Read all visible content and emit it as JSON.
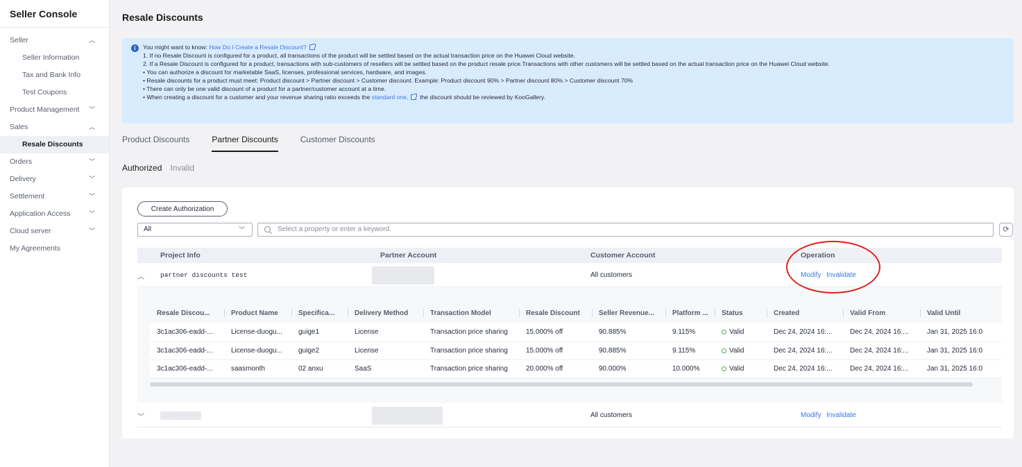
{
  "sidebar": {
    "title": "Seller Console",
    "items": [
      {
        "label": "Seller",
        "chevron": "︿"
      },
      {
        "label": "Seller Information"
      },
      {
        "label": "Tax and Bank Info"
      },
      {
        "label": "Test Coupons"
      },
      {
        "label": "Product Management",
        "chevron": "﹀"
      },
      {
        "label": "Sales",
        "chevron": "︿"
      },
      {
        "label": "Resale Discounts"
      },
      {
        "label": "Orders",
        "chevron": "﹀"
      },
      {
        "label": "Delivery",
        "chevron": "﹀"
      },
      {
        "label": "Settlement",
        "chevron": "﹀"
      },
      {
        "label": "Application Access",
        "chevron": "﹀"
      },
      {
        "label": "Cloud server",
        "chevron": "﹀"
      },
      {
        "label": "My Agreements"
      }
    ]
  },
  "page": {
    "title": "Resale Discounts"
  },
  "notice": {
    "icon": "info-icon",
    "intro": "You might want to know: ",
    "intro_link": "How Do I Create a Resale Discount?",
    "line1": "1. If no Resale Discount is configured for a product, all transactions of the product will be settled based on the actual transaction price on the Huawei Cloud website.",
    "line2": "2. If a Resale Discount is configured for a product, transactions with sub-customers of resellers will be settled based on the product resale price.Transactions with other customers will be settled based on the actual transaction price on the Huawei Cloud website.",
    "line3": "• You can authorize a discount for marketable SaaS, licenses, professional services, hardware, and images.",
    "line4": "• Resale discounts for a product must meet: Product discount > Partner discount > Customer discount. Example: Product discount 90% > Partner discount 80% > Customer discount 70%",
    "line5": "• There can only be one valid discount of a product for a partner/customer account at a time.",
    "line6_a": "• When creating a discount for a customer and your revenue sharing ratio exceeds the ",
    "line6_link": "standard one,",
    "line6_b": "  the discount should be reviewed by KooGallery."
  },
  "tabs": [
    "Product Discounts",
    "Partner Discounts",
    "Customer Discounts"
  ],
  "subtabs": [
    "Authorized",
    "Invalid"
  ],
  "toolbar": {
    "create_label": "Create Authorization",
    "filter_value": "All",
    "search_placeholder": "Select a property or enter a keyword.",
    "refresh_icon": "refresh-icon"
  },
  "outer_table": {
    "headers": [
      "Project Info",
      "Partner Account",
      "Customer Account",
      "Operation"
    ],
    "rows": [
      {
        "project": "partner discounts test",
        "customer": "All customers",
        "modify": "Modify",
        "invalidate": "Invalidate"
      },
      {
        "project": "",
        "customer": "All customers",
        "modify": "Modify",
        "invalidate": "Invalidate"
      }
    ]
  },
  "inner_table": {
    "headers": [
      "Resale Discou...",
      "Product Name",
      "Specifica...",
      "Delivery Method",
      "Transaction Model",
      "Resale Discount",
      "Seller Revenue...",
      "Platform ...",
      "Status",
      "Created",
      "Valid From",
      "Valid Until"
    ],
    "rows": [
      [
        "3c1ac306-eadd-...",
        "License-duogu...",
        "guige1",
        "License",
        "Transaction price sharing",
        "15.000% off",
        "90.885%",
        "9.115%",
        "Valid",
        "Dec 24, 2024 16:...",
        "Dec 24, 2024 16:...",
        "Jan 31, 2025 16:0"
      ],
      [
        "3c1ac306-eadd-...",
        "License-duogu...",
        "guige2",
        "License",
        "Transaction price sharing",
        "15.000% off",
        "90.885%",
        "9.115%",
        "Valid",
        "Dec 24, 2024 16:...",
        "Dec 24, 2024 16:...",
        "Jan 31, 2025 16:0"
      ],
      [
        "3c1ac306-eadd-...",
        "saasmonth",
        "02 anxu",
        "SaaS",
        "Transaction price sharing",
        "20.000% off",
        "90.000%",
        "10.000%",
        "Valid",
        "Dec 24, 2024 16:...",
        "Dec 24, 2024 16:...",
        "Jan 31, 2025 16:0"
      ]
    ]
  },
  "colors": {
    "accent": "#3a77e8",
    "annotation": "#e0201c",
    "valid": "#4caf50",
    "notice_bg": "#d9ecfd"
  }
}
